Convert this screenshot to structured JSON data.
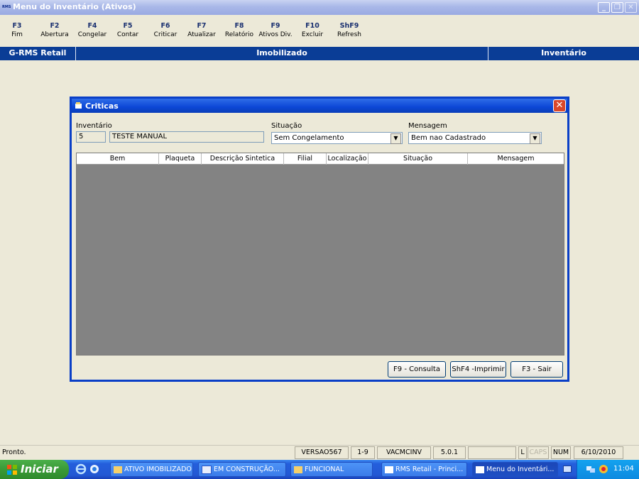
{
  "window": {
    "title": "Menu do Inventário (Ativos)",
    "logo_text": "RMS"
  },
  "fkeys": [
    {
      "key": "F3",
      "label": "Fim"
    },
    {
      "key": "F2",
      "label": "Abertura"
    },
    {
      "key": "F4",
      "label": "Congelar"
    },
    {
      "key": "F5",
      "label": "Contar"
    },
    {
      "key": "F6",
      "label": "Criticar"
    },
    {
      "key": "F7",
      "label": "Atualizar"
    },
    {
      "key": "F8",
      "label": "Relatório"
    },
    {
      "key": "F9",
      "label": "Ativos Div."
    },
    {
      "key": "F10",
      "label": "Excluir"
    },
    {
      "key": "ShF9",
      "label": "Refresh"
    }
  ],
  "modbar": {
    "left": "G-RMS Retail",
    "center": "Imobilizado",
    "right": "Inventário"
  },
  "dialog": {
    "title": "Criticas",
    "inventario_label": "Inventário",
    "inventario_code": "5",
    "inventario_desc": "TESTE MANUAL",
    "situacao_label": "Situação",
    "situacao_value": "Sem Congelamento",
    "mensagem_label": "Mensagem",
    "mensagem_value": "Bem nao Cadastrado",
    "columns": [
      "Bem",
      "Plaqueta",
      "Descrição Sintetica",
      "Filial",
      "Localização",
      "Situação",
      "Mensagem"
    ],
    "buttons": {
      "consulta": "F9 - Consulta",
      "imprimir": "ShF4 -Imprimir",
      "sair": "F3 - Sair"
    },
    "close_glyph": "✕"
  },
  "statusbar": {
    "text": "Pronto.",
    "panels": [
      "VERSAO567",
      "1-9",
      "VACMCINV",
      "5.0.1",
      "",
      "L",
      "CAPS",
      "NUM",
      "6/10/2010"
    ]
  },
  "taskbar": {
    "start": "Iniciar",
    "items": [
      "ATIVO IMOBILIZADO",
      "EM CONSTRUÇÃO...",
      "FUNCIONAL",
      "RMS Retail - Princi...",
      "Menu do Inventári..."
    ],
    "clock": "11:04"
  },
  "colors": {
    "module_bar": "#0a3d96",
    "dialog_border": "#0a3fc7",
    "grid_bg": "#838383"
  }
}
